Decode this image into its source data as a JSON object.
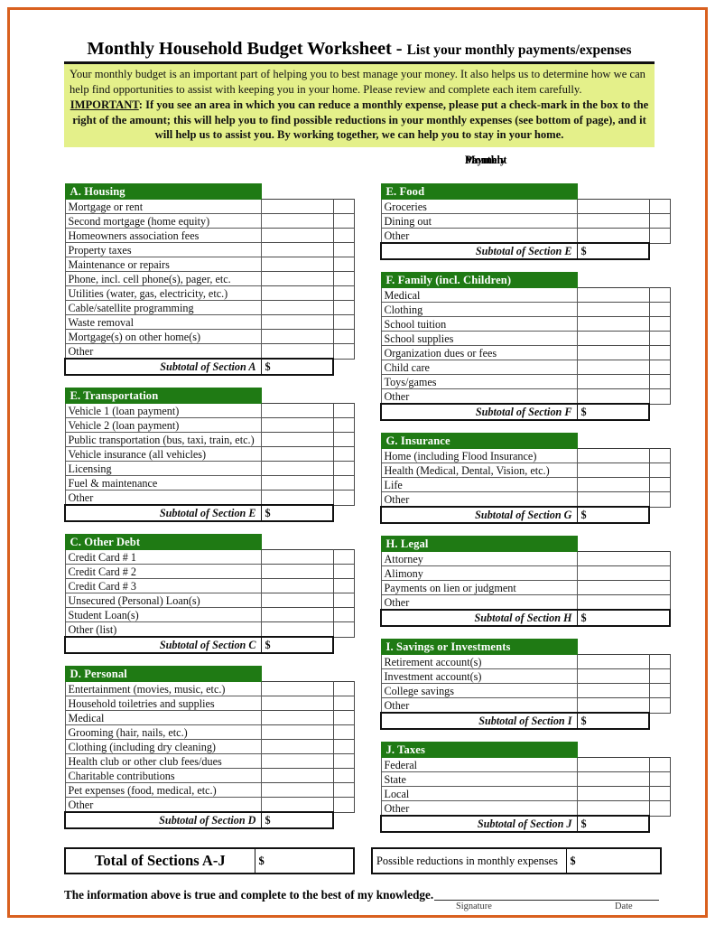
{
  "page": {
    "border_color": "#d9601f",
    "header_green": "#1f7a14",
    "notice_yellow": "#e4f08a"
  },
  "title": {
    "main": "Monthly Household Budget Worksheet",
    "separator": " - ",
    "sub": "List your monthly payments/expenses"
  },
  "notice": {
    "paragraph": "Your monthly budget is an important part of helping you to best manage your money. It also helps us to determine how we can help find opportunities to assist with keeping you in your home. Please review and complete each item carefully.",
    "important_word": "IMPORTANT",
    "important_text": ": If you see an area in which you can reduce a monthly expense, please put a check-mark in the box to the right of the amount; this will help you to find possible reductions in your monthly expenses (see bottom of page), and it will help us to assist you. By working together, we can help you to stay in your home."
  },
  "column_caption": {
    "line1": "Monthly",
    "line2": "Payment"
  },
  "currency_symbol": "$",
  "left_sections": [
    {
      "header": "A. Housing",
      "has_checkbox": true,
      "rows": [
        "Mortgage or rent",
        "Second mortgage (home equity)",
        "Homeowners association fees",
        "Property taxes",
        "Maintenance or repairs",
        "Phone, incl. cell phone(s), pager, etc.",
        "Utilities (water, gas, electricity, etc.)",
        "Cable/satellite programming",
        "Waste removal",
        "Mortgage(s) on other home(s)",
        "Other"
      ],
      "subtotal_label": "Subtotal of Section A"
    },
    {
      "header": "E. Transportation",
      "has_checkbox": true,
      "rows": [
        "Vehicle 1 (loan payment)",
        "Vehicle 2 (loan payment)",
        "Public transportation (bus, taxi, train, etc.)",
        "Vehicle insurance (all vehicles)",
        "Licensing",
        "Fuel & maintenance",
        "Other"
      ],
      "subtotal_label": "Subtotal of Section E"
    },
    {
      "header": "C. Other Debt",
      "has_checkbox": true,
      "rows": [
        "Credit Card # 1",
        "Credit Card # 2",
        "Credit Card # 3",
        "Unsecured (Personal) Loan(s)",
        "Student Loan(s)",
        "Other (list)"
      ],
      "subtotal_label": "Subtotal of Section C"
    },
    {
      "header": "D. Personal",
      "has_checkbox": true,
      "rows": [
        "Entertainment (movies, music, etc.)",
        "Household toiletries and supplies",
        "Medical",
        "Grooming (hair, nails, etc.)",
        "Clothing (including dry cleaning)",
        "Health club or other club fees/dues",
        "Charitable contributions",
        "Pet expenses (food, medical, etc.)",
        "Other"
      ],
      "subtotal_label": "Subtotal of Section D"
    }
  ],
  "right_sections": [
    {
      "header": "E. Food",
      "has_checkbox": true,
      "rows": [
        "Groceries",
        "Dining out",
        "Other"
      ],
      "subtotal_label": "Subtotal of Section E"
    },
    {
      "header": "F. Family (incl. Children)",
      "has_checkbox": true,
      "rows": [
        "Medical",
        "Clothing",
        "School tuition",
        "School supplies",
        "Organization dues or fees",
        "Child care",
        "Toys/games",
        "Other"
      ],
      "subtotal_label": "Subtotal of Section F"
    },
    {
      "header": "G. Insurance",
      "has_checkbox": true,
      "rows": [
        "Home (including Flood Insurance)",
        "Health (Medical, Dental, Vision, etc.)",
        "Life",
        "Other"
      ],
      "subtotal_label": "Subtotal of Section G"
    },
    {
      "header": "H. Legal",
      "has_checkbox": false,
      "rows": [
        "Attorney",
        "Alimony",
        "Payments on lien or judgment",
        "Other"
      ],
      "subtotal_label": "Subtotal of Section H"
    },
    {
      "header": "I. Savings or Investments",
      "has_checkbox": true,
      "rows": [
        "Retirement account(s)",
        "Investment account(s)",
        "College savings",
        "Other"
      ],
      "subtotal_label": "Subtotal of Section I"
    },
    {
      "header": "J. Taxes",
      "has_checkbox": true,
      "rows": [
        "Federal",
        "State",
        "Local",
        "Other"
      ],
      "subtotal_label": "Subtotal of Section J"
    }
  ],
  "footer": {
    "total_label": "Total of Sections A-J",
    "total_value": "$",
    "reductions_label": "Possible reductions in monthly expenses",
    "reductions_value": "$",
    "attestation": "The information above is true and complete to the best of my knowledge.",
    "signature_label": "Signature",
    "date_label": "Date"
  }
}
